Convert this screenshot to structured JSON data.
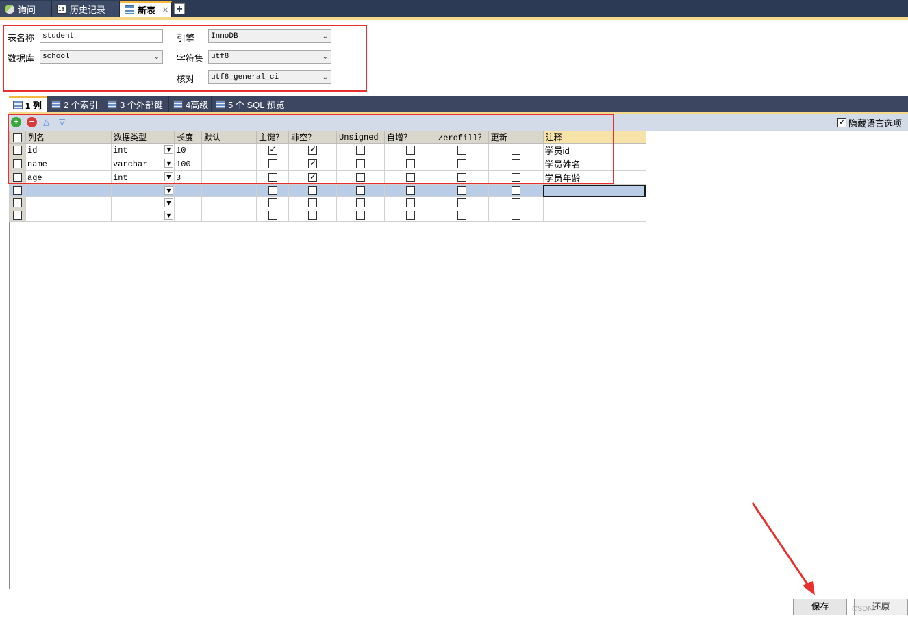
{
  "tabs": [
    {
      "label": "询问",
      "icon": "query-icon"
    },
    {
      "label": "历史记录",
      "icon": "history-icon"
    },
    {
      "label": "新表",
      "icon": "table-icon",
      "active": true
    }
  ],
  "form": {
    "table_name_label": "表名称",
    "table_name_value": "student",
    "database_label": "数据库",
    "database_value": "school",
    "engine_label": "引擎",
    "engine_value": "InnoDB",
    "charset_label": "字符集",
    "charset_value": "utf8",
    "collation_label": "核对",
    "collation_value": "utf8_general_ci"
  },
  "subtabs": [
    {
      "label": "1 列",
      "active": true
    },
    {
      "label": "2 个索引"
    },
    {
      "label": "3 个外部键"
    },
    {
      "label": "4高级"
    },
    {
      "label": "5 个 SQL 预览"
    }
  ],
  "toolbar": {
    "hide_lang_label": "隐藏语言选项",
    "hide_lang_checked": true
  },
  "columns_header": [
    "列名",
    "数据类型",
    "长度",
    "默认",
    "主键？",
    "非空？",
    "Unsigned",
    "自增？",
    "Zerofill？",
    "更新",
    "注释"
  ],
  "rows": [
    {
      "name": "id",
      "type": "int",
      "length": "10",
      "default": "",
      "pk": true,
      "notnull": true,
      "unsigned": false,
      "autoinc": false,
      "zerofill": false,
      "update": false,
      "comment": "学员id"
    },
    {
      "name": "name",
      "type": "varchar",
      "length": "100",
      "default": "",
      "pk": false,
      "notnull": true,
      "unsigned": false,
      "autoinc": false,
      "zerofill": false,
      "update": false,
      "comment": "学员姓名"
    },
    {
      "name": "age",
      "type": "int",
      "length": "3",
      "default": "",
      "pk": false,
      "notnull": true,
      "unsigned": false,
      "autoinc": false,
      "zerofill": false,
      "update": false,
      "comment": "学员年龄"
    },
    {
      "name": "",
      "type": "",
      "length": "",
      "default": "",
      "pk": false,
      "notnull": false,
      "unsigned": false,
      "autoinc": false,
      "zerofill": false,
      "update": false,
      "comment": "",
      "selected": true
    },
    {
      "name": "",
      "type": "",
      "length": "",
      "default": "",
      "pk": false,
      "notnull": false,
      "unsigned": false,
      "autoinc": false,
      "zerofill": false,
      "update": false,
      "comment": ""
    },
    {
      "name": "",
      "type": "",
      "length": "",
      "default": "",
      "pk": false,
      "notnull": false,
      "unsigned": false,
      "autoinc": false,
      "zerofill": false,
      "update": false,
      "comment": ""
    }
  ],
  "buttons": {
    "save": "保存",
    "revert": "还原"
  },
  "watermark": "CSDN",
  "colors": {
    "tabbar": "#2c3a55",
    "accent": "#f5d98a",
    "annotation_red": "#e8302f",
    "selection": "#b9cde6"
  }
}
